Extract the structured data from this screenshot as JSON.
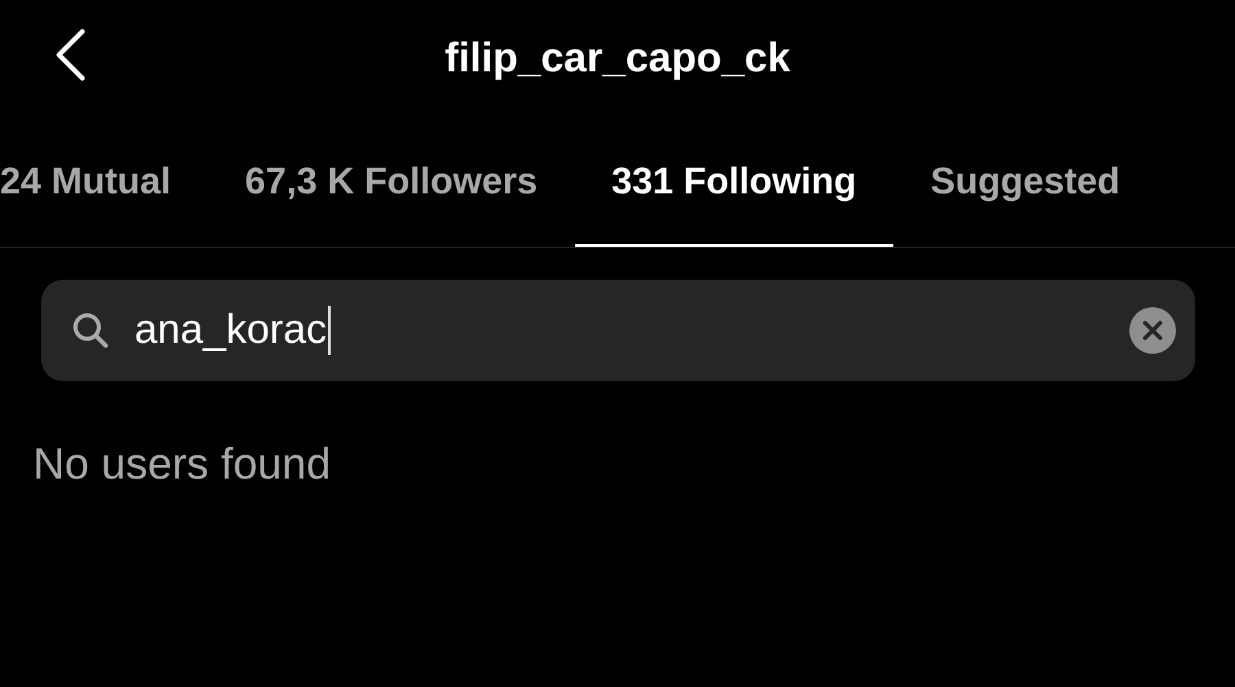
{
  "header": {
    "title": "filip_car_capo_ck"
  },
  "tabs": [
    {
      "label": "24 Mutual",
      "selected": false
    },
    {
      "label": "67,3 K Followers",
      "selected": false
    },
    {
      "label": "331 Following",
      "selected": true
    },
    {
      "label": "Suggested",
      "selected": false
    }
  ],
  "search": {
    "value": "ana_korac"
  },
  "message": "No users found"
}
